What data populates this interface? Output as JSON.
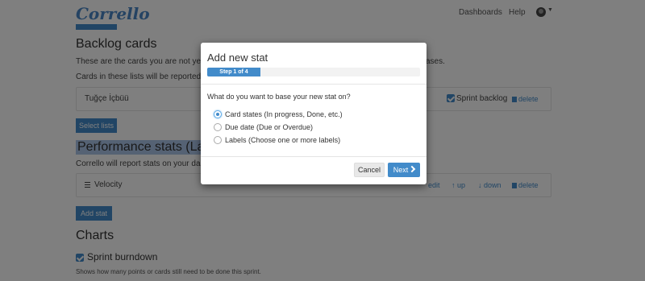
{
  "app": {
    "logo": "Corrello"
  },
  "nav": {
    "dashboards": "Dashboards",
    "help": "Help"
  },
  "backlog": {
    "heading": "Backlog cards",
    "desc1_start": "These are the cards you are not yet w",
    "desc1_end": "ases.",
    "desc2": "Cards in these lists will be reported a",
    "row": {
      "name": "Tuğçe İçbüü",
      "checkbox_label": "Sprint backlog",
      "delete": "delete"
    },
    "select_lists": "Select lists"
  },
  "performance": {
    "heading": "Performance stats (Labe",
    "desc": "Corrello will report stats on your das",
    "row": {
      "name": "Velocity",
      "edit": "edit",
      "up": "up",
      "down": "down",
      "delete": "delete"
    },
    "add_stat": "Add stat"
  },
  "charts": {
    "heading": "Charts",
    "burndown_label": "Sprint burndown",
    "burndown_desc": "Shows how many points or cards still need to be done this sprint."
  },
  "modal": {
    "title": "Add new stat",
    "step": "Step 1 of 4",
    "progress_fraction": 0.25,
    "question": "What do you want to base your new stat on?",
    "options": [
      {
        "label": "Card states (In progress, Done, etc.)",
        "checked": true
      },
      {
        "label": "Due date (Due or Overdue)",
        "checked": false
      },
      {
        "label": "Labels (Choose one or more labels)",
        "checked": false
      }
    ],
    "cancel": "Cancel",
    "next": "Next"
  },
  "colors": {
    "primary": "#428bca",
    "overlay": "rgba(0,0,0,0.5)",
    "logo": "#4a87c6"
  }
}
